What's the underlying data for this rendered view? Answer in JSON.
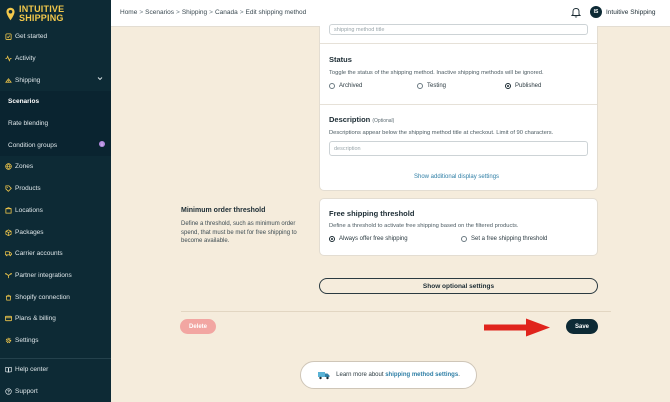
{
  "app": {
    "logo_line1": "INTUITIVE",
    "logo_line2": "SHIPPING",
    "brand_color": "#f2c84b"
  },
  "sidebar": {
    "items": [
      {
        "label": "Get started",
        "icon": "clipboard-check-icon"
      },
      {
        "label": "Activity",
        "icon": "activity-icon"
      },
      {
        "label": "Shipping",
        "icon": "shipping-icon"
      },
      {
        "label": "Scenarios"
      },
      {
        "label": "Rate blending"
      },
      {
        "label": "Condition groups",
        "badge": "i"
      },
      {
        "label": "Zones",
        "icon": "globe-icon"
      },
      {
        "label": "Products",
        "icon": "tag-icon"
      },
      {
        "label": "Locations",
        "icon": "location-icon"
      },
      {
        "label": "Packages",
        "icon": "package-icon"
      },
      {
        "label": "Carrier accounts",
        "icon": "truck-icon"
      },
      {
        "label": "Partner integrations",
        "icon": "integrations-icon"
      },
      {
        "label": "Shopify connection",
        "icon": "shopify-icon"
      },
      {
        "label": "Plans & billing",
        "icon": "card-icon"
      },
      {
        "label": "Settings",
        "icon": "gear-icon"
      }
    ],
    "bottom": [
      {
        "label": "Help center",
        "icon": "book-icon"
      },
      {
        "label": "Support",
        "icon": "help-icon"
      }
    ]
  },
  "topbar": {
    "breadcrumb": [
      "Home",
      "Scenarios",
      "Shipping",
      "Canada",
      "Edit shipping method"
    ],
    "separator": ">",
    "user_initials": "IS",
    "user_name": "Intuitive Shipping"
  },
  "form": {
    "title_placeholder": "shipping method title",
    "status": {
      "title": "Status",
      "help": "Toggle the status of the shipping method. Inactive shipping methods will be ignored.",
      "options": [
        "Archived",
        "Testing",
        "Published"
      ],
      "selected": "Published"
    },
    "description": {
      "title": "Description",
      "optional": "(Optional)",
      "help": "Descriptions appear below the shipping method title at checkout. Limit of 90 characters.",
      "placeholder": "description"
    },
    "show_additional": "Show additional display settings",
    "min_order": {
      "title": "Minimum order threshold",
      "help": "Define a threshold, such as minimum order spend, that must be met for free shipping to become available."
    },
    "free_shipping": {
      "title": "Free shipping threshold",
      "help": "Define a threshold to activate free shipping based on the filtered products.",
      "options": [
        "Always offer free shipping",
        "Set a free shipping threshold"
      ],
      "selected": "Always offer free shipping"
    },
    "show_optional": "Show optional settings",
    "delete_label": "Delete",
    "save_label": "Save",
    "learn_prefix": "Learn more about",
    "learn_link": "shipping method settings",
    "learn_suffix": "."
  }
}
